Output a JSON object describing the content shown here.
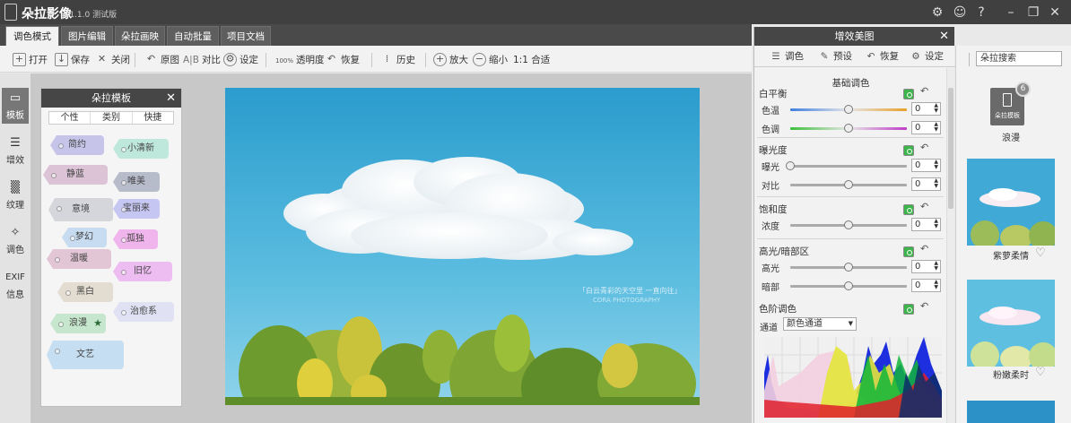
{
  "app": {
    "title": "朵拉影像",
    "version": "v1.1.0 测试版",
    "window_buttons": [
      "settings-icon",
      "feedback-icon",
      "help-icon",
      "minimize-icon",
      "restore-icon",
      "close-icon"
    ]
  },
  "tabs": [
    {
      "label": "调色模式",
      "active": true
    },
    {
      "label": "图片编辑",
      "active": false
    },
    {
      "label": "朵拉画映",
      "active": false
    },
    {
      "label": "自动批量",
      "active": false
    },
    {
      "label": "项目文档",
      "active": false
    }
  ],
  "toolbar": {
    "open": "打开",
    "save": "保存",
    "close": "关闭",
    "original": "原图",
    "compare_icon": "A|B",
    "compare": "对比",
    "settings": "设定",
    "opacity_icon": "100%",
    "opacity": "透明度",
    "restore": "恢复",
    "history": "历史",
    "zoom_in": "放大",
    "zoom_out": "缩小",
    "fit": "1:1 合适"
  },
  "leftnav": [
    {
      "label": "模板",
      "icon": "template-icon",
      "active": true
    },
    {
      "label": "增效",
      "icon": "sliders-icon",
      "active": false
    },
    {
      "label": "纹理",
      "icon": "texture-icon",
      "active": false
    },
    {
      "label": "调色",
      "icon": "magic-wand-icon",
      "active": false
    },
    {
      "label": "信息",
      "icon_text": "EXIF",
      "active": false
    }
  ],
  "template_panel": {
    "title": "朵拉模板",
    "subtabs": [
      "个性",
      "类别",
      "快捷"
    ],
    "tags": [
      {
        "label": "简约",
        "color": "#c7c4ea"
      },
      {
        "label": "小清新",
        "color": "#bfe8dd"
      },
      {
        "label": "静蓝",
        "color": "#dcc3d6"
      },
      {
        "label": "唯美",
        "color": "#b7bccb"
      },
      {
        "label": "意境",
        "color": "#d5d5dc"
      },
      {
        "label": "宝丽来",
        "color": "#c5c6f2"
      },
      {
        "label": "梦幻",
        "color": "#c7dcf0"
      },
      {
        "label": "孤独",
        "color": "#f0b5ec"
      },
      {
        "label": "温暖",
        "color": "#e2c6d6"
      },
      {
        "label": "旧忆",
        "color": "#edbdf1"
      },
      {
        "label": "黑白",
        "color": "#e3dcd0"
      },
      {
        "label": "浪漫",
        "color": "#c6e6cd",
        "starred": true
      },
      {
        "label": "治愈系",
        "color": "#e0e2f4"
      },
      {
        "label": "文艺",
        "color": "#c6def2"
      }
    ]
  },
  "photo": {
    "watermark_line1": "「白云青彩的天空里 一直向往」",
    "watermark_line2": "CORA PHOTOGRAPHY"
  },
  "adjust_panel": {
    "title": "增效美图",
    "tools": [
      "调色",
      "预设",
      "恢复",
      "设定"
    ],
    "section_title": "基础调色",
    "groups": [
      {
        "title": "白平衡",
        "sliders": [
          {
            "label": "色温",
            "value": "0",
            "level": 0.5
          },
          {
            "label": "色调",
            "value": "0",
            "level": 0.5
          }
        ]
      },
      {
        "title": "曝光度",
        "sliders": [
          {
            "label": "曝光",
            "value": "0",
            "level": 0.0
          },
          {
            "label": "对比",
            "value": "0",
            "level": 0.5
          }
        ]
      },
      {
        "title": "饱和度",
        "sliders": [
          {
            "label": "浓度",
            "value": "0",
            "level": 0.5
          }
        ]
      },
      {
        "title": "高光/暗部区",
        "sliders": [
          {
            "label": "高光",
            "value": "0",
            "level": 0.5
          },
          {
            "label": "暗部",
            "value": "0",
            "level": 0.5
          }
        ]
      }
    ],
    "levels": {
      "title": "色阶调色",
      "channel_label": "通道",
      "channel_value": "颜色通道"
    }
  },
  "right_panel": {
    "search_value": "朵拉搜索",
    "featured": {
      "label": "朵拉模板",
      "badge": "6",
      "caption": "浪漫"
    },
    "presets": [
      {
        "caption": "紫萝柔情"
      },
      {
        "caption": "粉嫩柔时"
      }
    ]
  }
}
